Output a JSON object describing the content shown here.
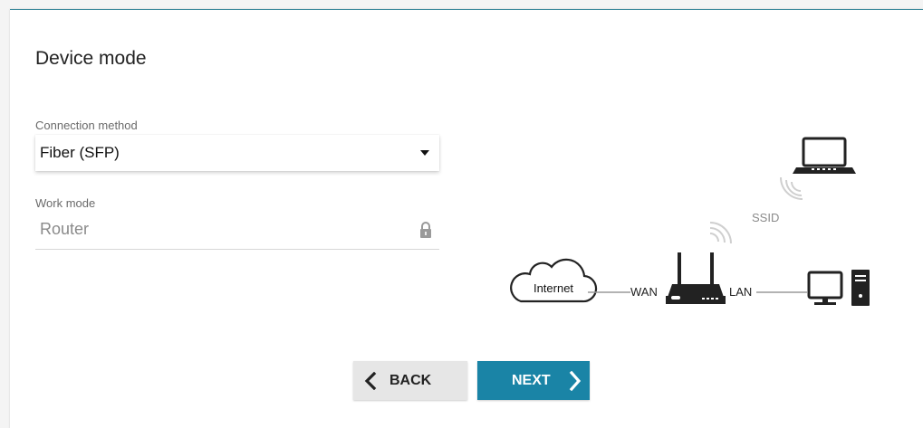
{
  "page": {
    "title": "Device mode"
  },
  "connection": {
    "label": "Connection method",
    "value": "Fiber (SFP)"
  },
  "work_mode": {
    "label": "Work mode",
    "value": "Router"
  },
  "diagram": {
    "internet_label": "Internet",
    "wan_label": "WAN",
    "lan_label": "LAN",
    "ssid_label": "SSID"
  },
  "buttons": {
    "back_label": "BACK",
    "next_label": "NEXT"
  },
  "colors": {
    "accent": "#1a84a6",
    "back_button": "#e6e6e6",
    "card_top_border": "#3d8a9c"
  },
  "icons": {
    "dropdown": "chevron-down-icon",
    "lock": "lock-icon",
    "back": "chevron-left-icon",
    "next": "chevron-right-icon",
    "cloud": "cloud-icon",
    "router": "router-icon",
    "laptop": "laptop-icon",
    "desktop": "desktop-computer-icon",
    "wifi": "wifi-signal-icon"
  }
}
